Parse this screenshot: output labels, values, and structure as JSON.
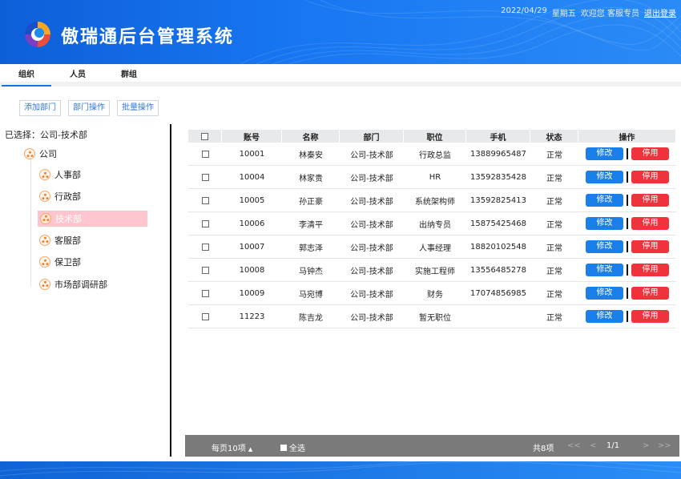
{
  "app": {
    "title": "傲瑞通后台管理系统"
  },
  "topbar": {
    "date": "2022/04/29",
    "weekday": "星期五",
    "welcome": "欢迎您 客服专员",
    "logout": "退出登录"
  },
  "tabs": [
    {
      "label": "组织"
    },
    {
      "label": "人员"
    },
    {
      "label": "群组"
    }
  ],
  "toolbar": {
    "add": "添加部门",
    "dept_ops": "部门操作",
    "batch_ops": "批量操作"
  },
  "selection": {
    "text": "已选择：公司-技术部"
  },
  "tree": {
    "root": "公司",
    "children": [
      "人事部",
      "行政部",
      "技术部",
      "客服部",
      "保卫部",
      "市场部调研部"
    ],
    "active": "技术部"
  },
  "table": {
    "headers": [
      "账号",
      "名称",
      "部门",
      "职位",
      "手机",
      "状态",
      "操作"
    ],
    "rows": [
      {
        "account": "10001",
        "name": "林秦安",
        "dept": "公司-技术部",
        "title": "行政总监",
        "phone": "13889965487",
        "status": "正常"
      },
      {
        "account": "10004",
        "name": "林家贵",
        "dept": "公司-技术部",
        "title": "HR",
        "phone": "13592835428",
        "status": "正常"
      },
      {
        "account": "10005",
        "name": "孙正豪",
        "dept": "公司-技术部",
        "title": "系统架构师",
        "phone": "13592825413",
        "status": "正常"
      },
      {
        "account": "10006",
        "name": "李清平",
        "dept": "公司-技术部",
        "title": "出纳专员",
        "phone": "15875425468",
        "status": "正常"
      },
      {
        "account": "10007",
        "name": "郭志泽",
        "dept": "公司-技术部",
        "title": "人事经理",
        "phone": "18820102548",
        "status": "正常"
      },
      {
        "account": "10008",
        "name": "马钟杰",
        "dept": "公司-技术部",
        "title": "实施工程师",
        "phone": "13556485278",
        "status": "正常"
      },
      {
        "account": "10009",
        "name": "马宛博",
        "dept": "公司-技术部",
        "title": "财务",
        "phone": "17074856985",
        "status": "正常"
      },
      {
        "account": "11223",
        "name": "陈吉龙",
        "dept": "公司-技术部",
        "title": "暂无职位",
        "phone": "",
        "status": "正常"
      }
    ],
    "edit_label": "修改",
    "stop_label": "停用"
  },
  "pager": {
    "per_page": "每页10项",
    "select_all": "全选",
    "total": "共8项",
    "first": "<<",
    "prev": "<",
    "page": "1/1",
    "next": ">",
    "last": ">>"
  },
  "colors": {
    "header_blue": "#1877f2",
    "edit_blue": "#1a7fe8",
    "stop_red": "#f0323d",
    "active_node": "#ffc5cf"
  }
}
